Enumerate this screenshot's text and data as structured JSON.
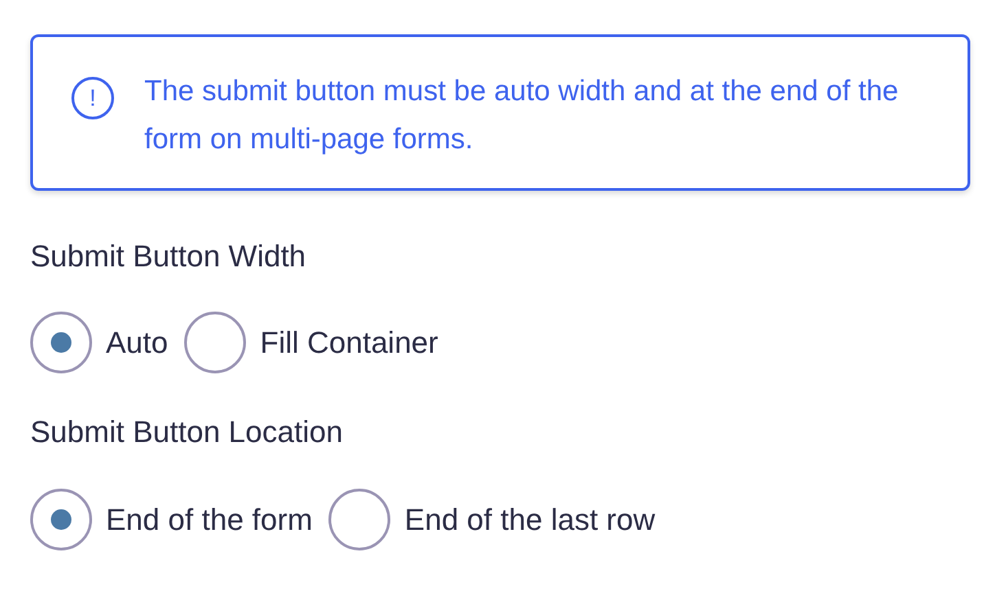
{
  "alert": {
    "icon": "!",
    "message": "The submit button must be auto width and at the end of the form on multi-page forms."
  },
  "groups": [
    {
      "label": "Submit Button Width",
      "options": [
        {
          "label": "Auto",
          "selected": true
        },
        {
          "label": "Fill Container",
          "selected": false
        }
      ]
    },
    {
      "label": "Submit Button Location",
      "options": [
        {
          "label": "End of the form",
          "selected": true
        },
        {
          "label": "End of the last row",
          "selected": false
        }
      ]
    }
  ]
}
